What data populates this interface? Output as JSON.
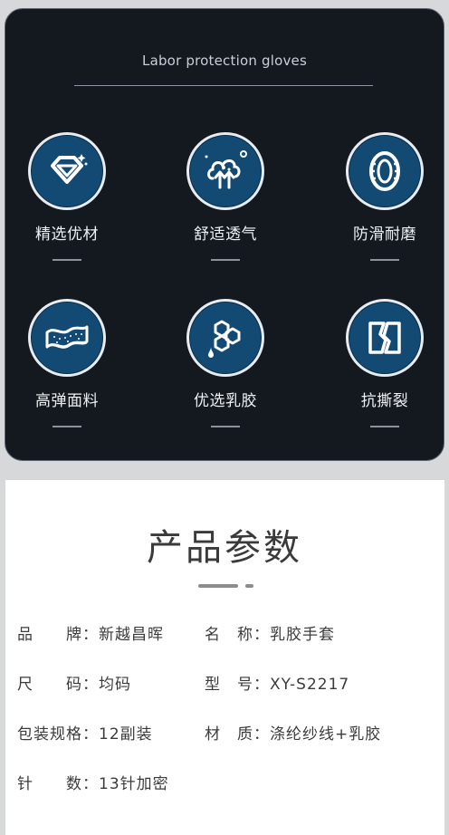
{
  "card_title": "Labor protection gloves",
  "features": [
    {
      "label": "精选优材",
      "icon": "diamond-icon"
    },
    {
      "label": "舒适透气",
      "icon": "breathable-icon"
    },
    {
      "label": "防滑耐磨",
      "icon": "tire-icon"
    },
    {
      "label": "高弹面料",
      "icon": "fabric-icon"
    },
    {
      "label": "优选乳胶",
      "icon": "latex-icon"
    },
    {
      "label": "抗撕裂",
      "icon": "tear-resistant-icon"
    }
  ],
  "params": {
    "title": "产品参数",
    "rows": [
      {
        "key": "品　　牌：",
        "value": "新越昌晖"
      },
      {
        "key": "名　称：",
        "value": "乳胶手套"
      },
      {
        "key": "尺　　码：",
        "value": "均码"
      },
      {
        "key": "型　号：",
        "value": "XY-S2217"
      },
      {
        "key": "包装规格：",
        "value": "12副装"
      },
      {
        "key": "材　质：",
        "value": "涤纶纱线+乳胶"
      },
      {
        "key": "针　　数：",
        "value": "13针加密"
      }
    ]
  },
  "colors": {
    "dark_bg": "#14191f",
    "icon_circle": "#134a73",
    "accent_line": "#8a939c"
  }
}
